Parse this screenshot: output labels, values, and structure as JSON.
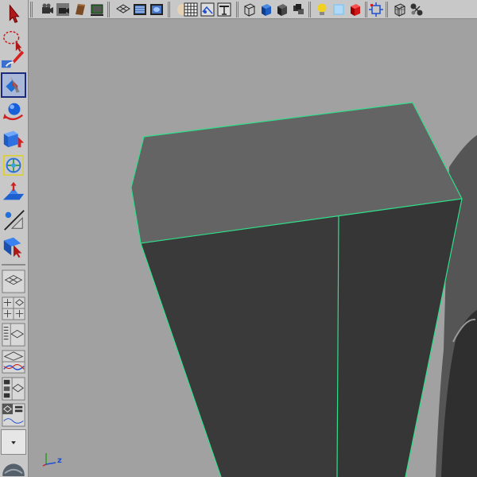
{
  "toolbox": {
    "tools": [
      {
        "name": "select-tool",
        "icon": "arrow-cursor-icon"
      },
      {
        "name": "lasso-tool",
        "icon": "lasso-icon"
      },
      {
        "name": "paint-select-tool",
        "icon": "paint-brush-icon"
      },
      {
        "name": "move-tool",
        "icon": "move-icon",
        "active": true
      },
      {
        "name": "rotate-tool",
        "icon": "rotate-icon"
      },
      {
        "name": "scale-tool",
        "icon": "scale-icon"
      },
      {
        "name": "universal-manipulator",
        "icon": "manipulator-icon"
      },
      {
        "name": "soft-modification-tool",
        "icon": "soft-mod-icon"
      },
      {
        "name": "show-manipulator-tool",
        "icon": "show-manip-icon"
      },
      {
        "name": "last-used-tool",
        "icon": "last-tool-icon"
      }
    ],
    "layouts": [
      {
        "name": "single-perspective-layout",
        "icon": "single-view-icon"
      },
      {
        "name": "four-view-layout",
        "icon": "four-view-icon"
      },
      {
        "name": "outliner-perspective-layout",
        "icon": "outliner-view-icon"
      },
      {
        "name": "graph-perspective-layout",
        "icon": "graph-view-icon"
      },
      {
        "name": "hypershade-perspective-layout",
        "icon": "hypershade-view-icon"
      },
      {
        "name": "custom-layout",
        "icon": "custom-layout-icon"
      },
      {
        "name": "layout-menu-button",
        "icon": "chevron-down-icon"
      }
    ]
  },
  "shelf": {
    "icons": [
      "select-camera-icon",
      "camera-attributes-icon",
      "bookmarks-icon",
      "image-plane-icon",
      "grid-icon",
      "film-gate-icon",
      "resolution-gate-icon",
      "wireframe-icon",
      "smooth-shade-icon",
      "flat-shade-icon",
      "shaded-wireframe-icon",
      "textured-icon",
      "high-quality-icon",
      "lights-icon",
      "xray-icon",
      "isolate-icon",
      "frame-icon",
      "resolution-icon",
      "shadows-icon"
    ]
  },
  "viewport": {
    "axis": {
      "x": "",
      "y": "",
      "z": "z"
    },
    "wire_color": "#2ee08a",
    "background": "#a1a1a1"
  }
}
